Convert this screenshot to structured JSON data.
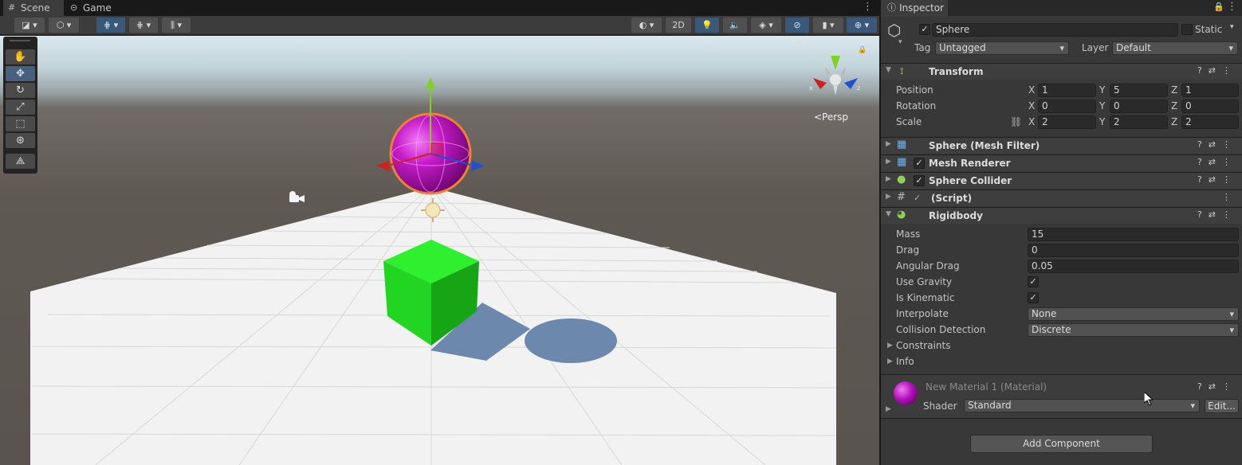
{
  "scene": {
    "tabs": [
      {
        "label": "Scene",
        "icon": "grid-icon"
      },
      {
        "label": "Game",
        "icon": "gamepad-icon"
      }
    ],
    "toolbar": {
      "mode_2d": "2D"
    },
    "gizmo": {
      "projection": "<Persp",
      "axis_x": "x",
      "axis_z": "z"
    },
    "tools": [
      "hand-tool",
      "move-tool",
      "rotate-tool",
      "scale-tool",
      "rect-tool",
      "transform-tool",
      "custom-tool"
    ]
  },
  "inspector": {
    "tab_label": "Inspector",
    "object": {
      "name": "Sphere",
      "static_label": "Static",
      "tag_label": "Tag",
      "tag_value": "Untagged",
      "layer_label": "Layer",
      "layer_value": "Default"
    },
    "transform": {
      "title": "Transform",
      "position": {
        "label": "Position",
        "x": "1",
        "y": "5",
        "z": "1"
      },
      "rotation": {
        "label": "Rotation",
        "x": "0",
        "y": "0",
        "z": "0"
      },
      "scale": {
        "label": "Scale",
        "x": "2",
        "y": "2",
        "z": "2"
      },
      "axis_x": "X",
      "axis_y": "Y",
      "axis_z": "Z"
    },
    "components": {
      "mesh_filter": "Sphere (Mesh Filter)",
      "mesh_renderer": "Mesh Renderer",
      "sphere_collider": "Sphere Collider",
      "script": "(Script)",
      "rigidbody": "Rigidbody"
    },
    "rigidbody": {
      "mass_label": "Mass",
      "mass": "15",
      "drag_label": "Drag",
      "drag": "0",
      "angular_drag_label": "Angular Drag",
      "angular_drag": "0.05",
      "use_gravity_label": "Use Gravity",
      "is_kinematic_label": "Is Kinematic",
      "interpolate_label": "Interpolate",
      "interpolate": "None",
      "collision_label": "Collision Detection",
      "collision": "Discrete",
      "constraints_label": "Constraints",
      "info_label": "Info"
    },
    "material": {
      "name": "New Material 1 (Material)",
      "shader_label": "Shader",
      "shader": "Standard",
      "edit_label": "Edit..."
    },
    "add_component": "Add Component"
  },
  "colors": {
    "sphere": "#b010b8",
    "cube": "#22dd22",
    "accent": "#3a5878"
  }
}
